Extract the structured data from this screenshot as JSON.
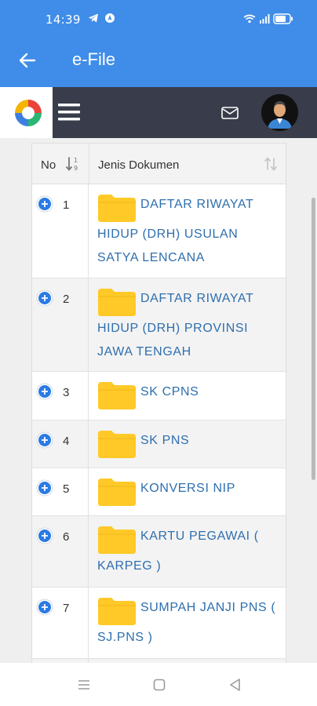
{
  "status_bar": {
    "time": "14:39",
    "battery": "68",
    "icons": [
      "telegram-icon",
      "location-icon",
      "wifi-icon",
      "signal-icon",
      "battery-icon"
    ]
  },
  "app_bar": {
    "title": "e-File",
    "back_icon": "arrow-left-icon"
  },
  "nav_bar": {
    "icons": [
      "app-logo-icon",
      "hamburger-menu-icon",
      "mail-icon",
      "user-avatar"
    ]
  },
  "table": {
    "columns": [
      {
        "label": "No",
        "sort_icon": "sort-numeric-asc-icon"
      },
      {
        "label": "Jenis Dokumen",
        "sort_icon": "sort-icon"
      }
    ],
    "rows": [
      {
        "no": "1",
        "label": "DAFTAR RIWAYAT HIDUP (DRH) USULAN SATYA LENCANA"
      },
      {
        "no": "2",
        "label": "DAFTAR RIWAYAT HIDUP (DRH) PROVINSI JAWA TENGAH"
      },
      {
        "no": "3",
        "label": "SK CPNS"
      },
      {
        "no": "4",
        "label": "SK PNS"
      },
      {
        "no": "5",
        "label": "KONVERSI NIP"
      },
      {
        "no": "6",
        "label": "KARTU PEGAWAI ( KARPEG )"
      },
      {
        "no": "7",
        "label": "SUMPAH JANJI PNS ( SJ.PNS )"
      }
    ]
  },
  "colors": {
    "app_bar": "#3f8de8",
    "nav_bar": "#393c4a",
    "link": "#2e6fae",
    "folder": "#ffc928",
    "plus_button": "#2a7be4"
  },
  "bottom_nav": {
    "icons": [
      "recent-apps-icon",
      "home-icon",
      "back-icon"
    ]
  }
}
